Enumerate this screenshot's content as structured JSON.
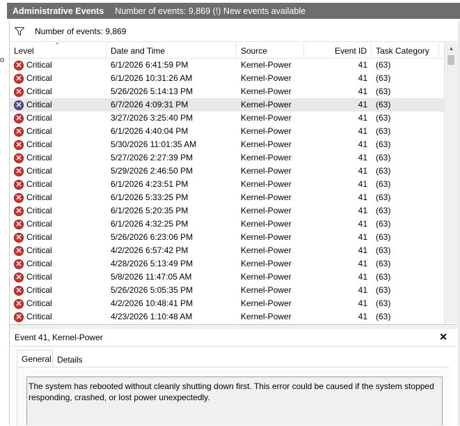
{
  "title": {
    "name": "Administrative Events",
    "event_count": "Number of events: 9,869 (!) New events available"
  },
  "left_edge_glyph": "o",
  "filter": {
    "icon": "filter-icon",
    "text": "Number of events: 9,869"
  },
  "columns": {
    "level": "Level",
    "date": "Date and Time",
    "source": "Source",
    "event_id": "Event ID",
    "task": "Task Category"
  },
  "sort_indicator": "^",
  "events": [
    {
      "level": "Critical",
      "date": "6/1/2026 6:41:59 PM",
      "source": "Kernel-Power",
      "event_id": "41",
      "task": "(63)"
    },
    {
      "level": "Critical",
      "date": "6/1/2026 10:31:26 AM",
      "source": "Kernel-Power",
      "event_id": "41",
      "task": "(63)"
    },
    {
      "level": "Critical",
      "date": "5/26/2026 5:14:13 PM",
      "source": "Kernel-Power",
      "event_id": "41",
      "task": "(63)"
    },
    {
      "level": "Critical",
      "date": "6/7/2026 4:09:31 PM",
      "source": "Kernel-Power",
      "event_id": "41",
      "task": "(63)",
      "selected": true
    },
    {
      "level": "Critical",
      "date": "3/27/2026 3:25:40 PM",
      "source": "Kernel-Power",
      "event_id": "41",
      "task": "(63)"
    },
    {
      "level": "Critical",
      "date": "6/1/2026 4:40:04 PM",
      "source": "Kernel-Power",
      "event_id": "41",
      "task": "(63)"
    },
    {
      "level": "Critical",
      "date": "5/30/2026 11:01:35 AM",
      "source": "Kernel-Power",
      "event_id": "41",
      "task": "(63)"
    },
    {
      "level": "Critical",
      "date": "5/27/2026 2:27:39 PM",
      "source": "Kernel-Power",
      "event_id": "41",
      "task": "(63)"
    },
    {
      "level": "Critical",
      "date": "5/29/2026 2:46:50 PM",
      "source": "Kernel-Power",
      "event_id": "41",
      "task": "(63)"
    },
    {
      "level": "Critical",
      "date": "6/1/2026 4:23:51 PM",
      "source": "Kernel-Power",
      "event_id": "41",
      "task": "(63)"
    },
    {
      "level": "Critical",
      "date": "6/1/2026 5:33:25 PM",
      "source": "Kernel-Power",
      "event_id": "41",
      "task": "(63)"
    },
    {
      "level": "Critical",
      "date": "6/1/2026 5:20:35 PM",
      "source": "Kernel-Power",
      "event_id": "41",
      "task": "(63)"
    },
    {
      "level": "Critical",
      "date": "6/1/2026 4:32:25 PM",
      "source": "Kernel-Power",
      "event_id": "41",
      "task": "(63)"
    },
    {
      "level": "Critical",
      "date": "5/26/2026 6:23:06 PM",
      "source": "Kernel-Power",
      "event_id": "41",
      "task": "(63)"
    },
    {
      "level": "Critical",
      "date": "4/2/2026 6:57:42 PM",
      "source": "Kernel-Power",
      "event_id": "41",
      "task": "(63)"
    },
    {
      "level": "Critical",
      "date": "4/28/2026 5:13:49 PM",
      "source": "Kernel-Power",
      "event_id": "41",
      "task": "(63)"
    },
    {
      "level": "Critical",
      "date": "5/8/2026 11:47:05 AM",
      "source": "Kernel-Power",
      "event_id": "41",
      "task": "(63)"
    },
    {
      "level": "Critical",
      "date": "5/26/2026 5:05:35 PM",
      "source": "Kernel-Power",
      "event_id": "41",
      "task": "(63)"
    },
    {
      "level": "Critical",
      "date": "4/2/2026 10:48:41 PM",
      "source": "Kernel-Power",
      "event_id": "41",
      "task": "(63)"
    },
    {
      "level": "Critical",
      "date": "4/23/2026 1:10:48 AM",
      "source": "Kernel-Power",
      "event_id": "41",
      "task": "(63)"
    }
  ],
  "critical_icon": "critical-error-icon",
  "critical_glyph": "✕",
  "detail": {
    "title": "Event 41, Kernel-Power",
    "close_glyph": "✕",
    "tabs": [
      "General",
      "Details"
    ],
    "description": "The system has rebooted without cleanly shutting down first. This error could be caused if the system stopped responding, crashed, or lost power unexpectedly."
  },
  "scroll": {
    "up_glyph": "▲"
  },
  "colors": {
    "title_bar": "#6d6d6d",
    "critical": "#d0312d",
    "selected_row": "#e8e8e8"
  }
}
